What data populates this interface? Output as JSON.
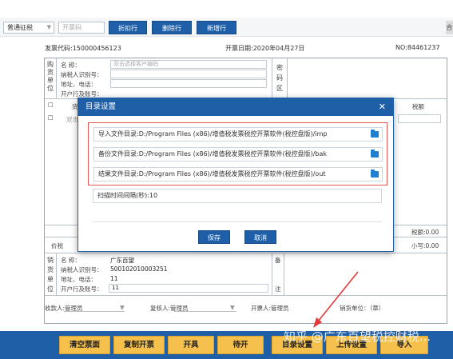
{
  "toolbar": {
    "invoice_type": "普通征税",
    "invoice_code_placeholder": "开票码",
    "buttons": [
      "折扣行",
      "删除行",
      "新增行"
    ],
    "corner": "合"
  },
  "invoice": {
    "code_label": "发票代码:",
    "code": "150000456123",
    "date_label": "开票日期:",
    "date": "2020年04月27日",
    "no_label": "NO:",
    "no": "84461237"
  },
  "buyer": {
    "side_label": [
      "购",
      "货",
      "单",
      "位"
    ],
    "name_label": "名      称：",
    "name_placeholder": "双击选择客户编码",
    "tax_id_label": "纳税人识别号：",
    "address_label": "地址、电话：",
    "bank_label": "开户行及账号：",
    "password_label": [
      "密",
      "码",
      "区"
    ]
  },
  "items": {
    "goods_label": "货",
    "double_click": "双击",
    "amount_label": "税额",
    "price_tax_label": "价税",
    "tax_total": "税额:0.00",
    "lower_case": "小写:0.00"
  },
  "seller": {
    "side_label": [
      "销",
      "货",
      "单",
      "位"
    ],
    "name_label": "名      称：",
    "name": "广东百望",
    "tax_id_label": "纳税人识别号：",
    "tax_id": "500102010003251",
    "address_label": "地址、电话：",
    "address": "11",
    "bank_label": "开户行及账号：",
    "bank": "11",
    "remark_label": [
      "备",
      "注"
    ]
  },
  "footer": {
    "payee_label": "收款人:",
    "payee": "管理员",
    "reviewer_label": "复核人:",
    "reviewer": "管理员",
    "issuer_label": "开票人:",
    "issuer": "管理员",
    "seller_label": "销货单位：（章）"
  },
  "actions": [
    "清空票面",
    "复制开票",
    "开具",
    "待开",
    "目录设置",
    "上传设置",
    "导入"
  ],
  "modal": {
    "title": "目录设置",
    "import_dir": "导入文件目录:D:/Program Files (x86)/增值税发票税控开票软件(税控盘版)/imp",
    "backup_dir": "备份文件目录:D:/Program Files (x86)/增值税发票税控开票软件(税控盘版)/bak",
    "result_dir": "结果文件目录:D:/Program Files (x86)/增值税发票税控开票软件(税控盘版)/out",
    "scan_interval": "扫描时间间隔(秒):10",
    "save": "保存",
    "cancel": "取消"
  },
  "watermark": "知乎 @广东百望税控财税...",
  "colors": {
    "primary_blue": "#1f5fa8",
    "action_yellow": "#f5c04b",
    "highlight_red": "#e05555"
  }
}
